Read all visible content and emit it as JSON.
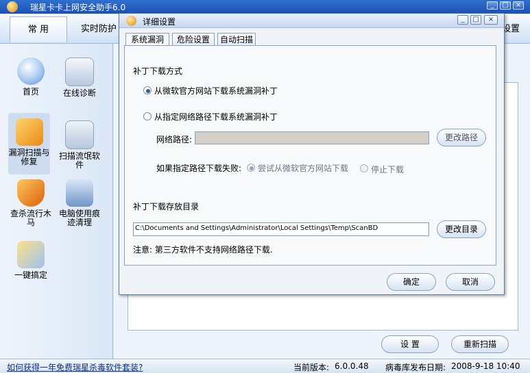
{
  "main": {
    "title": "瑞星卡卡上网安全助手6.0",
    "tabs": [
      {
        "label": "常  用"
      },
      {
        "label": "实时防护"
      },
      {
        "label": "网络设置"
      }
    ],
    "nav": [
      {
        "label": "首页",
        "icon": "home-icon"
      },
      {
        "label": "在线诊断",
        "icon": "diagnosis-icon"
      },
      {
        "label": "漏洞扫描与修复",
        "icon": "vulnerability-scan-icon"
      },
      {
        "label": "扫描流氓软件",
        "icon": "rogue-software-icon"
      },
      {
        "label": "查杀流行木马",
        "icon": "trojan-icon"
      },
      {
        "label": "电脑使用痕迹清理",
        "icon": "cleanup-icon"
      },
      {
        "label": "一键搞定",
        "icon": "one-click-icon"
      }
    ],
    "buttons": {
      "settings": "设  置",
      "rescan": "重新扫描"
    },
    "status": {
      "promo_link": "如何获得一年免费瑞星杀毒软件套装?",
      "version_label": "当前版本:",
      "version": "6.0.0.48",
      "db_label": "病毒库发布日期:",
      "db_date": "2008-9-18 10:40"
    }
  },
  "dialog": {
    "title": "详细设置",
    "tabs": [
      {
        "label": "系统漏洞",
        "active": true
      },
      {
        "label": "危险设置",
        "active": false
      },
      {
        "label": "自动扫描",
        "active": false
      }
    ],
    "download_method": {
      "heading": "补丁下载方式",
      "option_official": "从微软官方网站下载系统漏洞补丁",
      "option_custom": "从指定网络路径下载系统漏洞补丁",
      "selected": "official"
    },
    "network_path": {
      "label": "网络路径:",
      "value": "",
      "change_button": "更改路径"
    },
    "on_failure": {
      "label": "如果指定路径下载失败:",
      "option_retry": "尝试从微软官方网站下载",
      "option_stop": "停止下载",
      "selected": "retry"
    },
    "save_dir": {
      "heading": "补丁下载存放目录",
      "value": "C:\\Documents and Settings\\Administrator\\Local Settings\\Temp\\ScanBD",
      "change_button": "更改目录"
    },
    "note": "注意: 第三方软件不支持网络路径下载.",
    "ok_button": "确定",
    "cancel_button": "取消"
  }
}
